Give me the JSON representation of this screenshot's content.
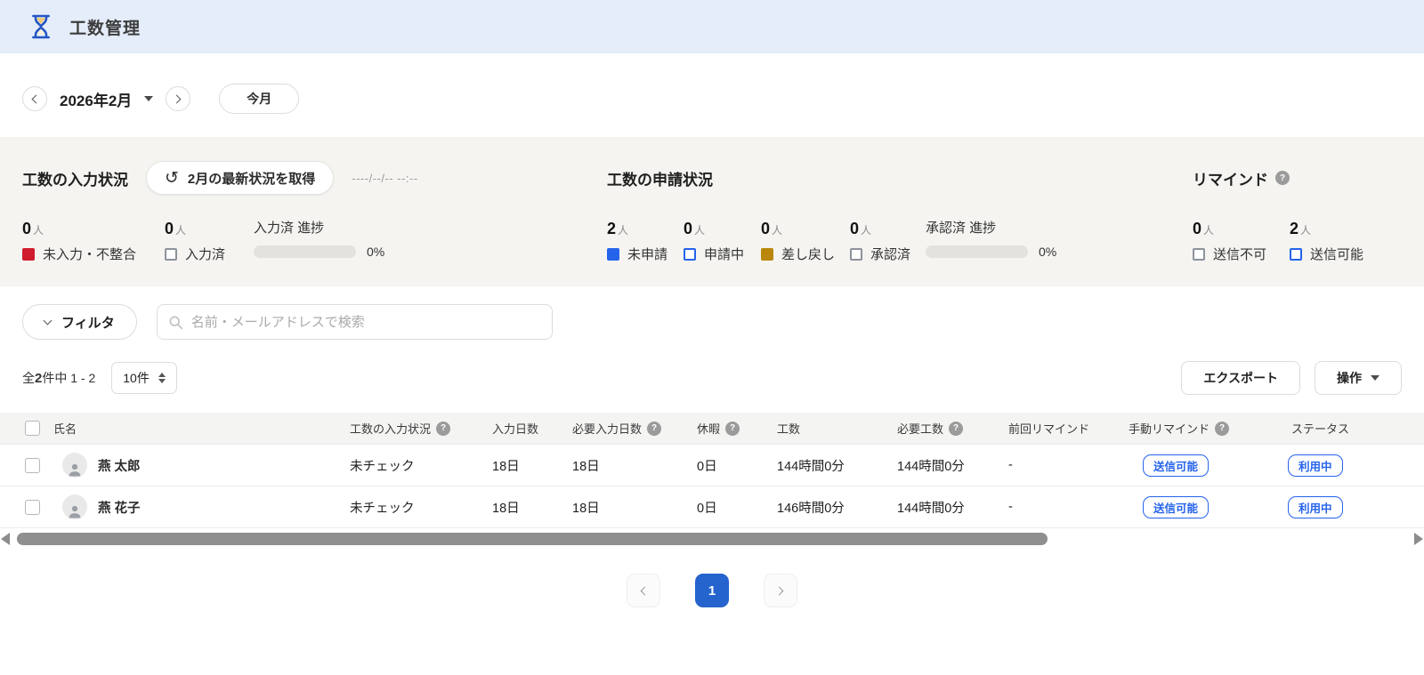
{
  "header": {
    "title": "工数管理"
  },
  "date_nav": {
    "current_month": "2026年2月",
    "today_label": "今月"
  },
  "input_status": {
    "title": "工数の入力状況",
    "refresh_label": "2月の最新状況を取得",
    "refresh_icon": "↺",
    "timestamp": "----/--/-- --:--",
    "stats": [
      {
        "count": "0",
        "unit": "人",
        "label": "未入力・不整合",
        "swatch_color": "#cf1b2b",
        "swatch_style": "filled"
      },
      {
        "count": "0",
        "unit": "人",
        "label": "入力済",
        "swatch_color": "#8d939c",
        "swatch_style": "outline"
      }
    ],
    "progress": {
      "label": "入力済 進捗",
      "percent": "0%",
      "value": 0
    }
  },
  "request_status": {
    "title": "工数の申請状況",
    "stats": [
      {
        "count": "2",
        "unit": "人",
        "label": "未申請",
        "swatch_color": "#2563eb",
        "swatch_style": "filled"
      },
      {
        "count": "0",
        "unit": "人",
        "label": "申請中",
        "swatch_color": "#2563eb",
        "swatch_style": "outline"
      },
      {
        "count": "0",
        "unit": "人",
        "label": "差し戻し",
        "swatch_color": "#b8870b",
        "swatch_style": "filled"
      },
      {
        "count": "0",
        "unit": "人",
        "label": "承認済",
        "swatch_color": "#8d939c",
        "swatch_style": "outline"
      }
    ],
    "progress": {
      "label": "承認済 進捗",
      "percent": "0%",
      "value": 0
    }
  },
  "remind": {
    "title": "リマインド",
    "stats": [
      {
        "count": "0",
        "unit": "人",
        "label": "送信不可",
        "swatch_color": "#8d939c",
        "swatch_style": "outline"
      },
      {
        "count": "2",
        "unit": "人",
        "label": "送信可能",
        "swatch_color": "#2563eb",
        "swatch_style": "outline"
      }
    ]
  },
  "filter": {
    "button_label": "フィルタ",
    "search_placeholder": "名前・メールアドレスで検索"
  },
  "list_controls": {
    "count_prefix": "全",
    "count_total": "2",
    "count_suffix": "件中 1 - 2",
    "page_size": "10件",
    "export_label": "エクスポート",
    "actions_label": "操作"
  },
  "table": {
    "columns": [
      {
        "label": "氏名"
      },
      {
        "label": "工数の入力状況",
        "help": true
      },
      {
        "label": "入力日数"
      },
      {
        "label": "必要入力日数",
        "help": true
      },
      {
        "label": "休暇",
        "help": true
      },
      {
        "label": "工数"
      },
      {
        "label": "必要工数",
        "help": true
      },
      {
        "label": "前回リマインド"
      },
      {
        "label": "手動リマインド",
        "help": true
      },
      {
        "label": "ステータス"
      }
    ],
    "rows": [
      {
        "name": "燕 太郎",
        "check_status": "未チェック",
        "input_days": "18日",
        "required_days": "18日",
        "vacation": "0日",
        "hours": "144時間0分",
        "required_hours": "144時間0分",
        "last_remind": "-",
        "manual_remind": "送信可能",
        "status": "利用中"
      },
      {
        "name": "燕 花子",
        "check_status": "未チェック",
        "input_days": "18日",
        "required_days": "18日",
        "vacation": "0日",
        "hours": "146時間0分",
        "required_hours": "144時間0分",
        "last_remind": "-",
        "manual_remind": "送信可能",
        "status": "利用中"
      }
    ]
  },
  "pagination": {
    "current_page": "1"
  },
  "colors": {
    "accent_blue": "#2563eb",
    "alert_red": "#cf1b2b",
    "warn_gold": "#b8870b",
    "header_bg": "#e4edf9",
    "panel_bg": "#f5f4f1",
    "pagination_active": "#2563cd"
  }
}
